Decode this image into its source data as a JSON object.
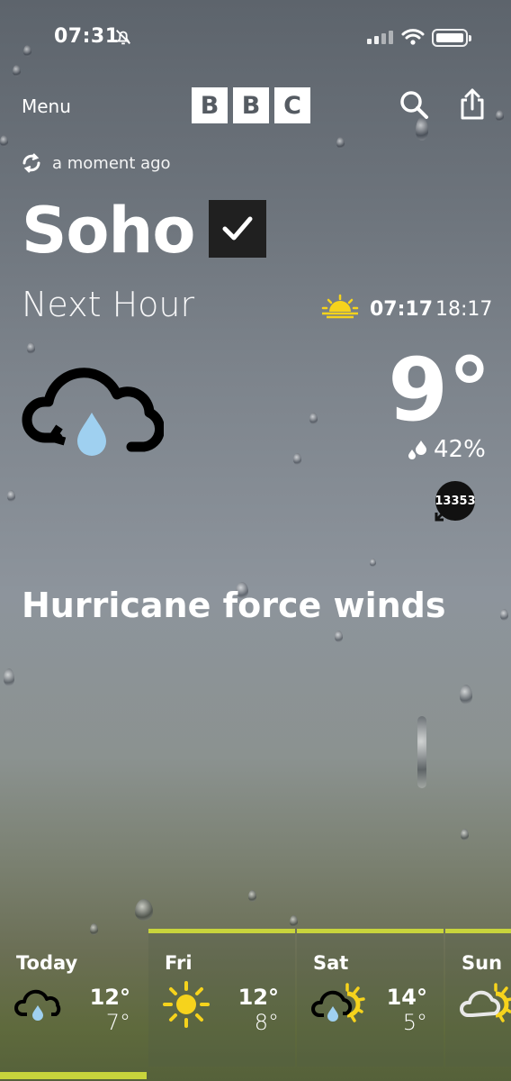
{
  "status_bar": {
    "time": "07:31"
  },
  "header": {
    "menu_label": "Menu",
    "logo_letters": [
      "B",
      "B",
      "C"
    ]
  },
  "updated_text": "a moment ago",
  "location": {
    "name": "Soho"
  },
  "next_hour": {
    "title": "Next Hour",
    "sunrise": "07:17",
    "sunset": "18:17",
    "temperature": "9°",
    "humidity": "42%",
    "wind_speed": "13353",
    "description": "Hurricane force winds"
  },
  "forecast": [
    {
      "day": "Today",
      "high": "12°",
      "low": "7°",
      "icon": "cloud-rain-icon"
    },
    {
      "day": "Fri",
      "high": "12°",
      "low": "8°",
      "icon": "sun-icon"
    },
    {
      "day": "Sat",
      "high": "14°",
      "low": "5°",
      "icon": "sun-cloud-rain-icon"
    },
    {
      "day": "Sun",
      "high": "",
      "low": "",
      "icon": "sun-cloud-icon"
    }
  ],
  "colors": {
    "accent": "#c8d43c",
    "sun": "#f6d31c",
    "rain_drop": "#9fd0f0"
  }
}
